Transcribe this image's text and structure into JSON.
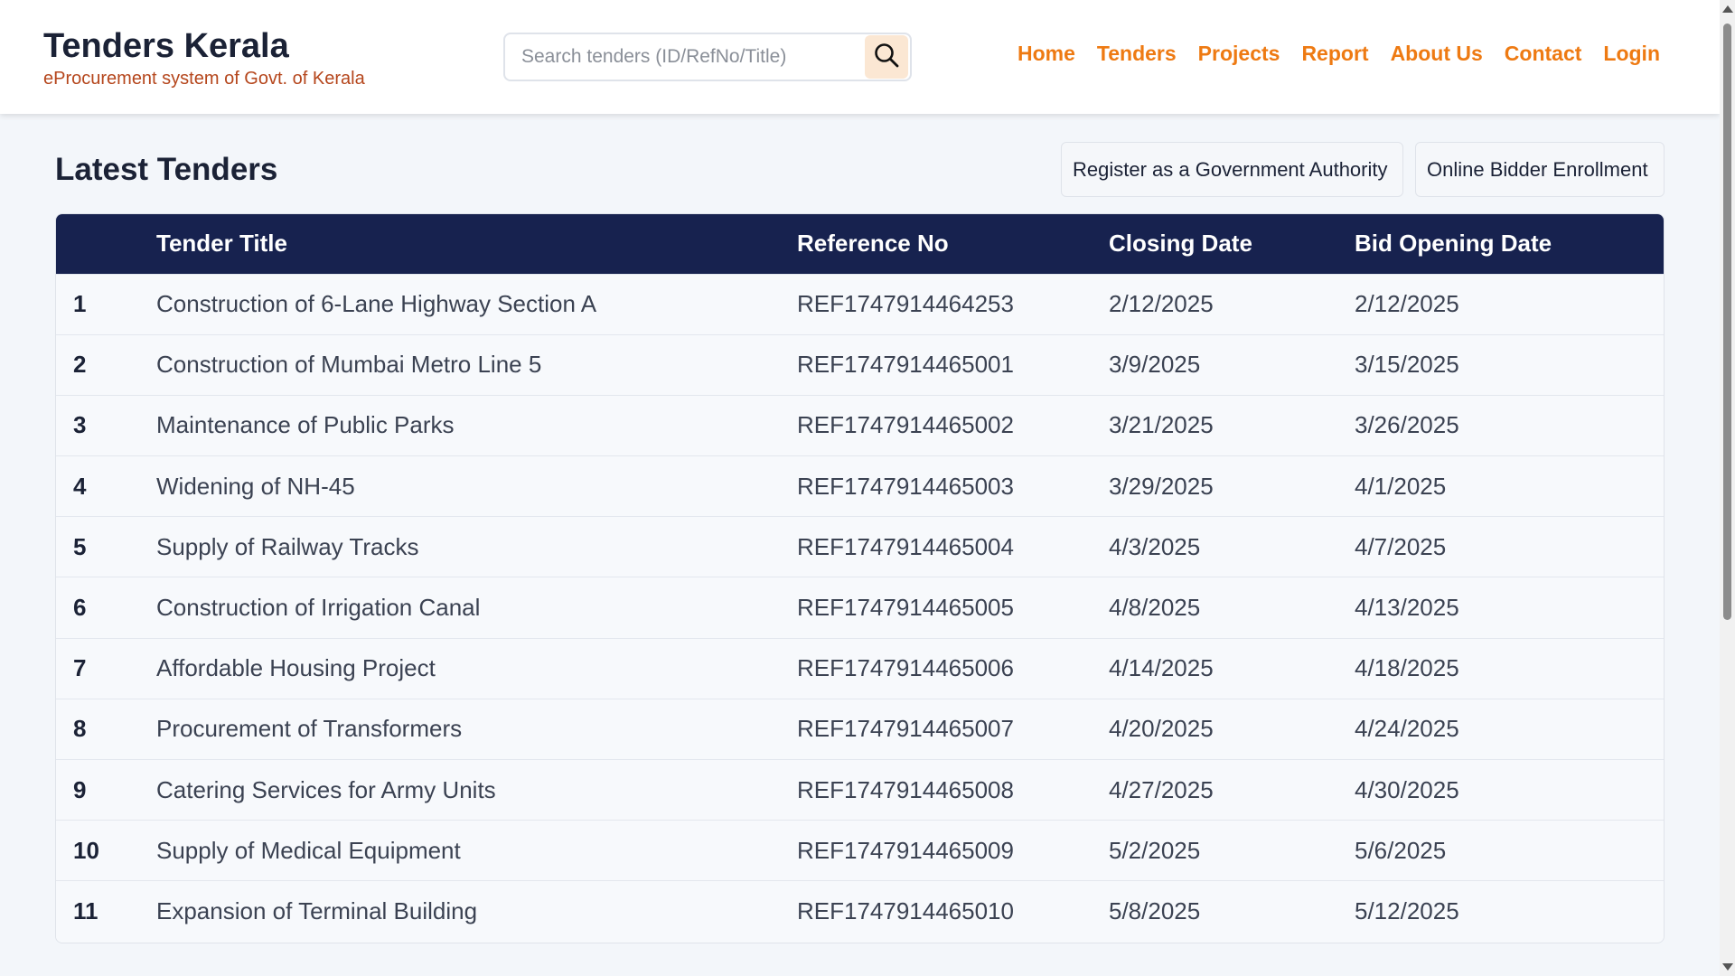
{
  "brand": {
    "title": "Tenders Kerala",
    "subtitle": "eProcurement system of Govt. of Kerala"
  },
  "search": {
    "placeholder": "Search tenders (ID/RefNo/Title)",
    "icon": "search-icon"
  },
  "nav": {
    "items": [
      "Home",
      "Tenders",
      "Projects",
      "Report",
      "About Us",
      "Contact",
      "Login"
    ]
  },
  "main": {
    "title": "Latest Tenders",
    "register_gov_label": "Register as a Government Authority",
    "bidder_enroll_label": "Online Bidder Enrollment"
  },
  "table": {
    "headers": [
      "",
      "Tender Title",
      "Reference No",
      "Closing Date",
      "Bid Opening Date"
    ],
    "rows": [
      {
        "num": "1",
        "title": "Construction of 6-Lane Highway Section A",
        "ref": "REF1747914464253",
        "closing": "2/12/2025",
        "opening": "2/12/2025"
      },
      {
        "num": "2",
        "title": "Construction of Mumbai Metro Line 5",
        "ref": "REF1747914465001",
        "closing": "3/9/2025",
        "opening": "3/15/2025"
      },
      {
        "num": "3",
        "title": "Maintenance of Public Parks",
        "ref": "REF1747914465002",
        "closing": "3/21/2025",
        "opening": "3/26/2025"
      },
      {
        "num": "4",
        "title": "Widening of NH-45",
        "ref": "REF1747914465003",
        "closing": "3/29/2025",
        "opening": "4/1/2025"
      },
      {
        "num": "5",
        "title": "Supply of Railway Tracks",
        "ref": "REF1747914465004",
        "closing": "4/3/2025",
        "opening": "4/7/2025"
      },
      {
        "num": "6",
        "title": "Construction of Irrigation Canal",
        "ref": "REF1747914465005",
        "closing": "4/8/2025",
        "opening": "4/13/2025"
      },
      {
        "num": "7",
        "title": "Affordable Housing Project",
        "ref": "REF1747914465006",
        "closing": "4/14/2025",
        "opening": "4/18/2025"
      },
      {
        "num": "8",
        "title": "Procurement of Transformers",
        "ref": "REF1747914465007",
        "closing": "4/20/2025",
        "opening": "4/24/2025"
      },
      {
        "num": "9",
        "title": "Catering Services for Army Units",
        "ref": "REF1747914465008",
        "closing": "4/27/2025",
        "opening": "4/30/2025"
      },
      {
        "num": "10",
        "title": "Supply of Medical Equipment",
        "ref": "REF1747914465009",
        "closing": "5/2/2025",
        "opening": "5/6/2025"
      },
      {
        "num": "11",
        "title": "Expansion of Terminal Building",
        "ref": "REF1747914465010",
        "closing": "5/8/2025",
        "opening": "5/12/2025"
      }
    ]
  },
  "colors": {
    "accent": "#ee7a12",
    "subtitle": "#b5461c",
    "table_header": "#17224f",
    "text_dark": "#1b2236"
  }
}
